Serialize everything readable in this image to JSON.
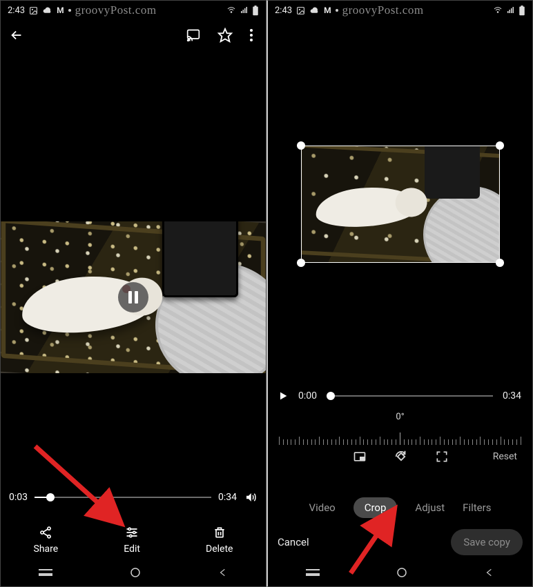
{
  "status": {
    "time": "2:43",
    "icons_left": [
      "image-icon",
      "cloud-icon",
      "gmail-icon",
      "dot-icon"
    ],
    "watermark": "groovyPost.com",
    "icons_right": [
      "wifi-icon",
      "signal-icon",
      "battery-icon"
    ]
  },
  "left": {
    "topbar": {
      "back": "←"
    },
    "scrub": {
      "current": "0:03",
      "total": "0:34",
      "progress_pct": 9
    },
    "actions": {
      "share": "Share",
      "edit": "Edit",
      "delete": "Delete"
    }
  },
  "right": {
    "play": {
      "current": "0:00",
      "total": "0:34",
      "progress_pct": 0
    },
    "angle": "0°",
    "tools": {
      "reset": "Reset"
    },
    "tabs": {
      "video": "Video",
      "crop": "Crop",
      "adjust": "Adjust",
      "filters": "Filters"
    },
    "bottom": {
      "cancel": "Cancel",
      "save": "Save copy"
    }
  }
}
